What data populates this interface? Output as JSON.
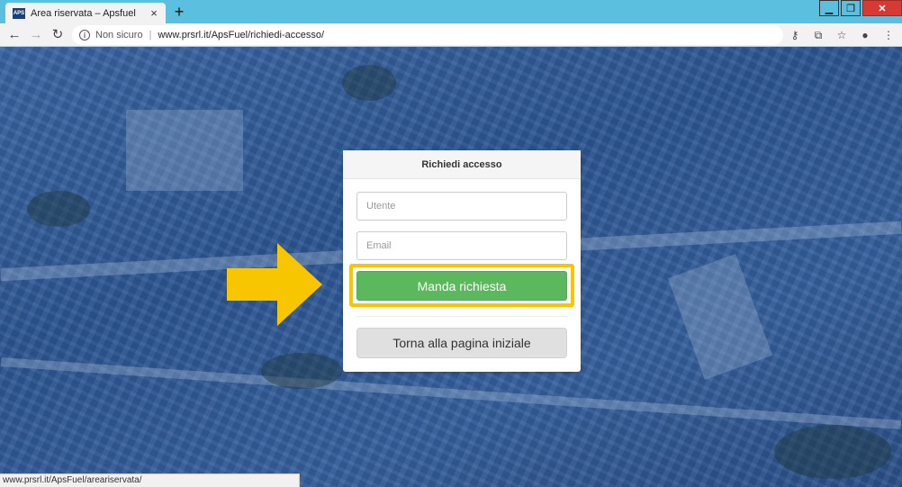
{
  "browser": {
    "tab_title": "Area riservata – Apsfuel",
    "favicon_text": "APS",
    "new_tab": "+",
    "tab_close": "×",
    "win": {
      "minimize": "▁",
      "restore": "❐",
      "close": "✕"
    },
    "nav": {
      "back": "←",
      "forward": "→",
      "reload": "↻"
    },
    "security_label": "Non sicuro",
    "url": "www.prsrl.it/ApsFuel/richiedi-accesso/",
    "icons": {
      "key": "⚷",
      "translate": "⧉",
      "bookmark": "☆",
      "profile": "●",
      "menu": "⋮"
    },
    "status_url": "www.prsrl.it/ApsFuel/areariservata/"
  },
  "form": {
    "title": "Richiedi accesso",
    "user_placeholder": "Utente",
    "email_placeholder": "Email",
    "submit_label": "Manda richiesta",
    "home_label": "Torna alla pagina iniziale"
  },
  "colors": {
    "accent_green": "#5cb85c",
    "highlight_yellow": "#f7c600",
    "overlay_blue": "#2f5a97"
  }
}
